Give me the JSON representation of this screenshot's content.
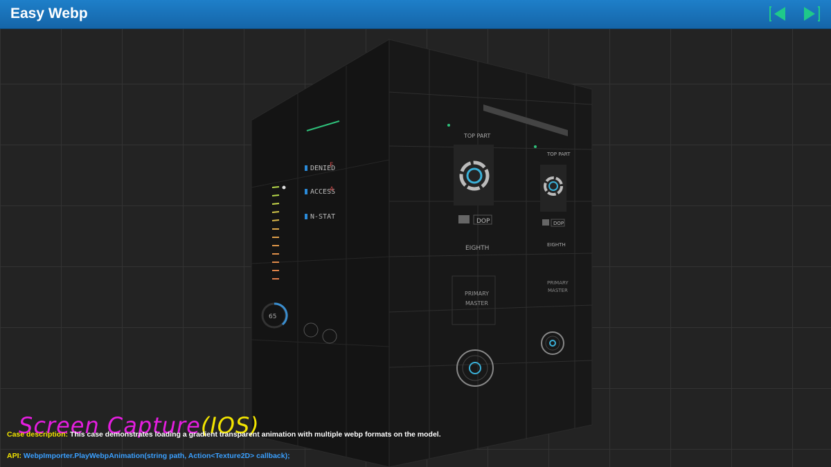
{
  "header": {
    "title": "Easy Webp",
    "prev_icon": "triangle-left-green-icon",
    "next_icon": "triangle-right-green-icon",
    "accent_color": "#1a73bd",
    "button_color": "#1fc98a"
  },
  "cube": {
    "left_face": {
      "rows": [
        "DENIED",
        "ACCESS",
        "N-STAT"
      ],
      "dial_value": "65"
    },
    "right_face": {
      "top_label": "TOP PART",
      "top_label_2": "TOP PART",
      "button_label": "DOP",
      "button_label_2": "DOP",
      "eighth": "EIGHTH",
      "eighth_2": "EIGHTH",
      "primary": "PRIMARY",
      "master": "MASTER",
      "primary_2": "PRIMARY",
      "master_2": "MASTER"
    }
  },
  "overlay": {
    "capture_title": "Screen Capture",
    "capture_tag": "(IOS)",
    "desc_label": "Case description:",
    "desc_text": "This case demonstrates loading a gradient transparent animation with multiple webp formats on the model.",
    "api_label": "API:",
    "api_text": "WebpImporter.PlayWebpAnimation(string path, Action<Texture2D> callback);"
  }
}
